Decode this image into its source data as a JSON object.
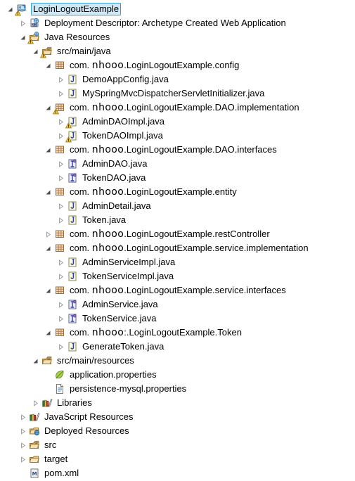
{
  "tree": {
    "name": "project-explorer-tree",
    "background": "#ffffff",
    "selection_fill": "#cde8f6",
    "selection_border": "#3c9fd4",
    "rows": [
      {
        "indent": 0,
        "twisty": "expanded",
        "icon": "web-project-icon",
        "icon_badge": "warning",
        "text": "LoginLogoutExample",
        "selected": true
      },
      {
        "indent": 1,
        "twisty": "collapsed",
        "icon": "deployment-descriptor-icon",
        "icon_badge": "none",
        "text": "Deployment Descriptor: Archetype Created Web Application",
        "selected": false
      },
      {
        "indent": 1,
        "twisty": "expanded",
        "icon": "java-resources-icon",
        "icon_badge": "warning",
        "text": "Java Resources",
        "selected": false
      },
      {
        "indent": 2,
        "twisty": "expanded",
        "icon": "source-folder-icon",
        "icon_badge": "warning",
        "text": "src/main/java",
        "selected": false
      },
      {
        "indent": 3,
        "twisty": "expanded",
        "icon": "package-icon",
        "icon_badge": "none",
        "text": "com. nhooo .LoginLogoutExample.config",
        "brand": "nhooo",
        "prefix": "com. ",
        "suffix": ".LoginLogoutExample.config",
        "selected": false
      },
      {
        "indent": 4,
        "twisty": "collapsed",
        "icon": "java-file-icon",
        "icon_badge": "none",
        "text": "DemoAppConfig.java",
        "selected": false
      },
      {
        "indent": 4,
        "twisty": "collapsed",
        "icon": "java-file-icon",
        "icon_badge": "none",
        "text": "MySpringMvcDispatcherServletInitializer.java",
        "selected": false
      },
      {
        "indent": 3,
        "twisty": "expanded",
        "icon": "package-icon",
        "icon_badge": "warning",
        "text": "com. nhooo .LoginLogoutExample.DAO.implementation",
        "brand": "nhooo",
        "prefix": "com. ",
        "suffix": ".LoginLogoutExample.DAO.implementation",
        "selected": false
      },
      {
        "indent": 4,
        "twisty": "collapsed",
        "icon": "java-file-icon",
        "icon_badge": "warning",
        "text": "AdminDAOImpl.java",
        "selected": false
      },
      {
        "indent": 4,
        "twisty": "collapsed",
        "icon": "java-file-icon",
        "icon_badge": "warning",
        "text": "TokenDAOImpl.java",
        "selected": false
      },
      {
        "indent": 3,
        "twisty": "expanded",
        "icon": "package-icon",
        "icon_badge": "none",
        "text": "com. nhooo .LoginLogoutExample.DAO.interfaces",
        "brand": "nhooo",
        "prefix": "com. ",
        "suffix": ".LoginLogoutExample.DAO.interfaces",
        "selected": false
      },
      {
        "indent": 4,
        "twisty": "collapsed",
        "icon": "java-interface-icon",
        "icon_badge": "none",
        "text": "AdminDAO.java",
        "selected": false
      },
      {
        "indent": 4,
        "twisty": "collapsed",
        "icon": "java-interface-icon",
        "icon_badge": "none",
        "text": "TokenDAO.java",
        "selected": false
      },
      {
        "indent": 3,
        "twisty": "expanded",
        "icon": "package-icon",
        "icon_badge": "none",
        "text": "com. nhooo .LoginLogoutExample.entity",
        "brand": "nhooo",
        "prefix": "com. ",
        "suffix": ".LoginLogoutExample.entity",
        "selected": false
      },
      {
        "indent": 4,
        "twisty": "collapsed",
        "icon": "java-file-icon",
        "icon_badge": "none",
        "text": "AdminDetail.java",
        "selected": false
      },
      {
        "indent": 4,
        "twisty": "collapsed",
        "icon": "java-file-icon",
        "icon_badge": "none",
        "text": "Token.java",
        "selected": false
      },
      {
        "indent": 3,
        "twisty": "collapsed",
        "icon": "package-icon",
        "icon_badge": "none",
        "text": "com. nhooo .LoginLogoutExample.restController",
        "brand": "nhooo",
        "prefix": "com. ",
        "suffix": ".LoginLogoutExample.restController",
        "selected": false
      },
      {
        "indent": 3,
        "twisty": "expanded",
        "icon": "package-icon",
        "icon_badge": "none",
        "text": "com. nhooo .LoginLogoutExample.service.implementation",
        "brand": "nhooo",
        "prefix": "com. ",
        "suffix": ".LoginLogoutExample.service.implementation",
        "selected": false
      },
      {
        "indent": 4,
        "twisty": "collapsed",
        "icon": "java-file-icon",
        "icon_badge": "none",
        "text": "AdminServiceImpl.java",
        "selected": false
      },
      {
        "indent": 4,
        "twisty": "collapsed",
        "icon": "java-file-icon",
        "icon_badge": "none",
        "text": "TokenServiceImpl.java",
        "selected": false
      },
      {
        "indent": 3,
        "twisty": "expanded",
        "icon": "package-icon",
        "icon_badge": "none",
        "text": "com. nhooo .LoginLogoutExample.service.interfaces",
        "brand": "nhooo",
        "prefix": "com. ",
        "suffix": ".LoginLogoutExample.service.interfaces",
        "selected": false
      },
      {
        "indent": 4,
        "twisty": "collapsed",
        "icon": "java-interface-icon",
        "icon_badge": "none",
        "text": "AdminService.java",
        "selected": false
      },
      {
        "indent": 4,
        "twisty": "collapsed",
        "icon": "java-interface-icon",
        "icon_badge": "none",
        "text": "TokenService.java",
        "selected": false
      },
      {
        "indent": 3,
        "twisty": "expanded",
        "icon": "package-icon",
        "icon_badge": "none",
        "text": "com. nhooo :.LoginLogoutExample.Token",
        "brand": "nhooo",
        "prefix": "com. ",
        "suffix": ":.LoginLogoutExample.Token",
        "selected": false
      },
      {
        "indent": 4,
        "twisty": "collapsed",
        "icon": "java-file-icon",
        "icon_badge": "none",
        "text": "GenerateToken.java",
        "selected": false
      },
      {
        "indent": 2,
        "twisty": "expanded",
        "icon": "source-folder-icon",
        "icon_badge": "none",
        "text": "src/main/resources",
        "selected": false
      },
      {
        "indent": 3,
        "twisty": "none",
        "icon": "properties-leaf-icon",
        "icon_badge": "none",
        "text": "application.properties",
        "selected": false
      },
      {
        "indent": 3,
        "twisty": "none",
        "icon": "properties-file-icon",
        "icon_badge": "none",
        "text": "persistence-mysql.properties",
        "selected": false
      },
      {
        "indent": 2,
        "twisty": "collapsed",
        "icon": "libraries-icon",
        "icon_badge": "none",
        "text": "Libraries",
        "selected": false
      },
      {
        "indent": 1,
        "twisty": "collapsed",
        "icon": "libraries-icon",
        "icon_badge": "none",
        "text": "JavaScript Resources",
        "selected": false
      },
      {
        "indent": 1,
        "twisty": "collapsed",
        "icon": "deployed-resources-icon",
        "icon_badge": "none",
        "text": "Deployed Resources",
        "selected": false
      },
      {
        "indent": 1,
        "twisty": "collapsed",
        "icon": "source-folder-icon",
        "icon_badge": "none",
        "text": "src",
        "selected": false
      },
      {
        "indent": 1,
        "twisty": "collapsed",
        "icon": "folder-icon",
        "icon_badge": "none",
        "text": "target",
        "selected": false
      },
      {
        "indent": 1,
        "twisty": "none",
        "icon": "maven-pom-icon",
        "icon_badge": "none",
        "text": "pom.xml",
        "selected": false
      }
    ]
  }
}
